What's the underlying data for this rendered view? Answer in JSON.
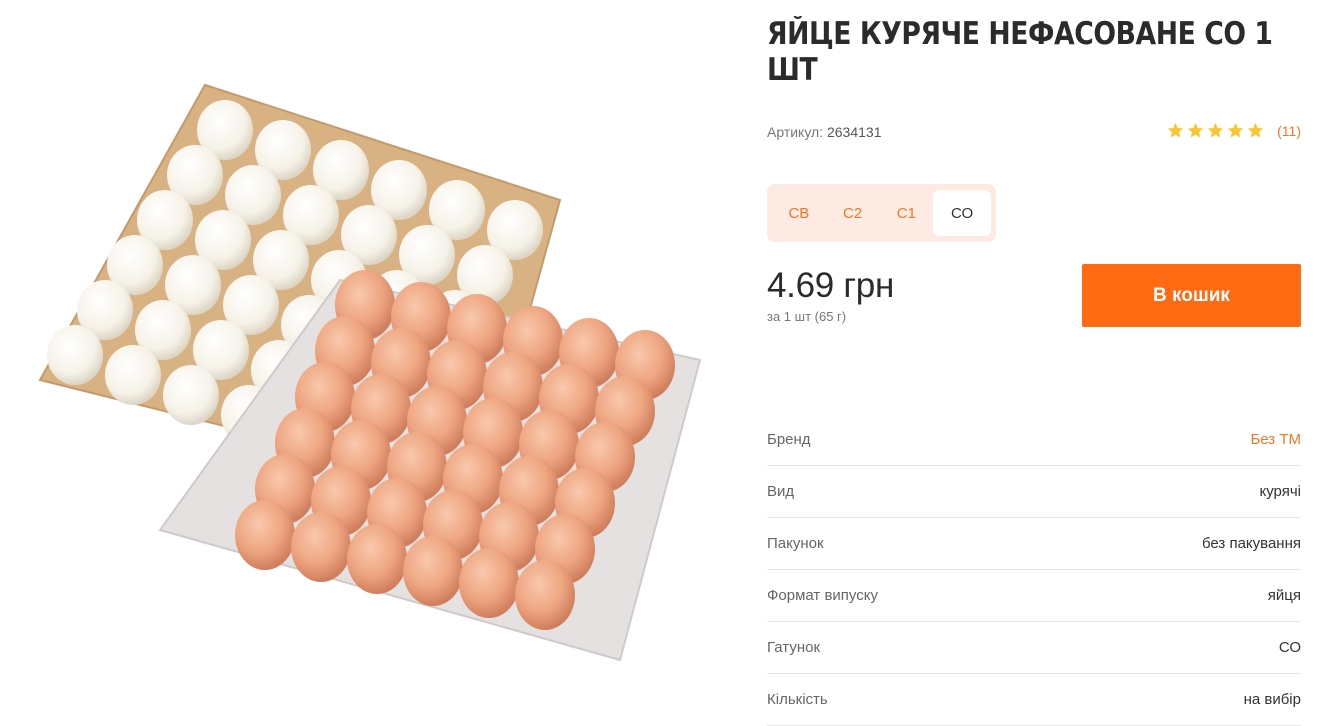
{
  "product": {
    "title": "ЯЙЦЕ КУРЯЧЕ НЕФАСОВАНЕ СО 1 ШТ",
    "sku_label": "Артикул:",
    "sku_value": "2634131",
    "rating": 5,
    "reviews": "(11)",
    "grades": [
      "СВ",
      "С2",
      "С1",
      "СО"
    ],
    "active_grade": "СО",
    "price": "4.69 грн",
    "price_note": "за 1 шт (65 г)",
    "cart_label": "В кошик",
    "image_icon": "egg-trays-photo"
  },
  "specs": [
    {
      "key": "Бренд",
      "value": "Без ТМ",
      "link": true
    },
    {
      "key": "Вид",
      "value": "курячі",
      "link": false
    },
    {
      "key": "Пакунок",
      "value": "без пакування",
      "link": false
    },
    {
      "key": "Формат випуску",
      "value": "яйця",
      "link": false
    },
    {
      "key": "Гатунок",
      "value": "СО",
      "link": false
    },
    {
      "key": "Кількість",
      "value": "на вибір",
      "link": false
    }
  ],
  "colors": {
    "accent": "#ff6a13",
    "link": "#f07828",
    "grade_bg": "#fdeae3",
    "star": "#f9c531"
  }
}
